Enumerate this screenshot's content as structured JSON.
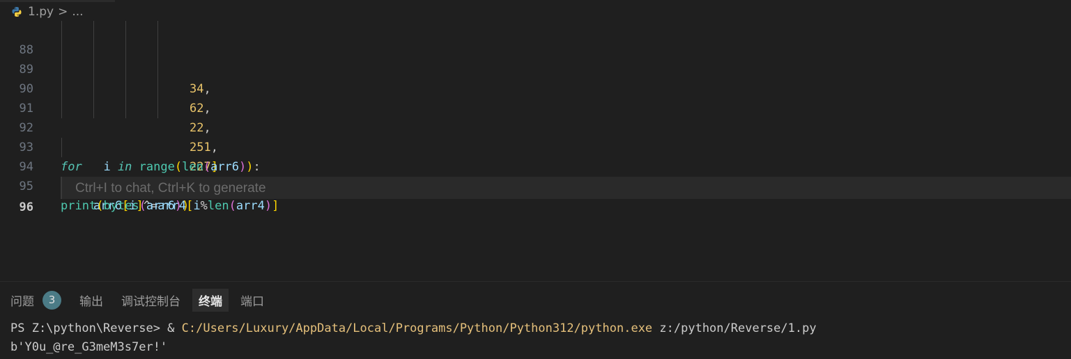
{
  "breadcrumb": {
    "file": "1.py",
    "separator": ">",
    "more": "..."
  },
  "editor": {
    "lines": [
      {
        "number": "88",
        "tokens": [
          "34",
          ","
        ]
      },
      {
        "number": "89",
        "tokens": [
          "62",
          ","
        ]
      },
      {
        "number": "90",
        "tokens": [
          "22",
          ","
        ]
      },
      {
        "number": "91",
        "tokens": [
          "251",
          ","
        ]
      },
      {
        "number": "92",
        "tokens": [
          "227",
          "]"
        ]
      },
      {
        "number": "93",
        "text": "for   i in range(len(arr6)):"
      },
      {
        "number": "94",
        "text": "arr6[i]^=arr4[i%len(arr4)]"
      },
      {
        "number": "95",
        "text": "print(bytes(arr6))"
      },
      {
        "number": "96",
        "text": ""
      }
    ],
    "hint": "Ctrl+I to chat, Ctrl+K to generate"
  },
  "panel": {
    "tabs": [
      {
        "label": "问题",
        "badge": "3"
      },
      {
        "label": "输出"
      },
      {
        "label": "调试控制台"
      },
      {
        "label": "终端",
        "active": true
      },
      {
        "label": "端口"
      }
    ]
  },
  "terminal": {
    "prompt": "PS Z:\\python\\Reverse> ",
    "amp": "& ",
    "exe": "C:/Users/Luxury/AppData/Local/Programs/Python/Python312/python.exe",
    "arg": " z:/python/Reverse/1.py",
    "output": "b'Y0u_@re_G3meM3s7er!'"
  },
  "colors": {
    "background": "#1f1f1f",
    "number": "#e9c46a",
    "keyword": "#56c5b5",
    "terminal_path": "#e5c07b"
  }
}
